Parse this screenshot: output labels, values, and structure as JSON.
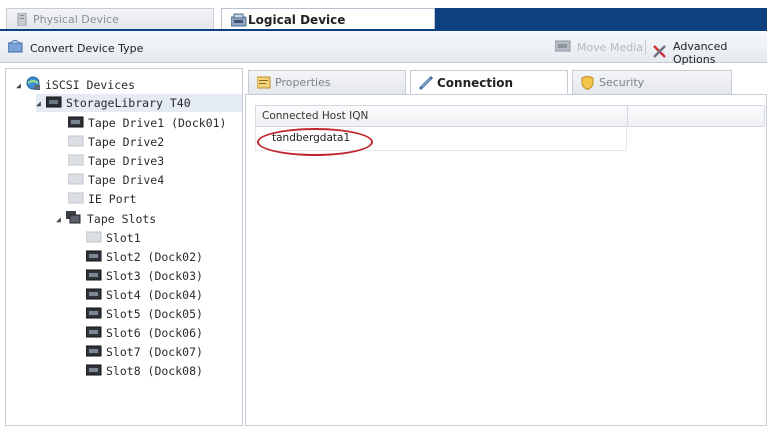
{
  "top_tabs": {
    "physical": "Physical Device",
    "logical": "Logical Device"
  },
  "toolbar": {
    "convert": "Convert Device Type",
    "move_media": "Move Media",
    "advanced": "Advanced Options"
  },
  "tree": {
    "root": "iSCSI Devices",
    "library": "StorageLibrary T40",
    "drives": [
      "Tape Drive1 (Dock01)",
      "Tape Drive2",
      "Tape Drive3",
      "Tape Drive4"
    ],
    "ie_port": "IE Port",
    "slots_group": "Tape Slots",
    "slots": [
      "Slot1",
      "Slot2 (Dock02)",
      "Slot3 (Dock03)",
      "Slot4 (Dock04)",
      "Slot5 (Dock05)",
      "Slot6 (Dock06)",
      "Slot7 (Dock07)",
      "Slot8 (Dock08)"
    ]
  },
  "pane_tabs": {
    "properties": "Properties",
    "connection": "Connection",
    "security": "Security"
  },
  "table": {
    "header": "Connected Host IQN",
    "rows": [
      "tandbergdata1"
    ]
  },
  "colors": {
    "title_band": "#0e3f7e",
    "highlight_circle": "#c0272d",
    "selection": "#e4ebf4"
  }
}
